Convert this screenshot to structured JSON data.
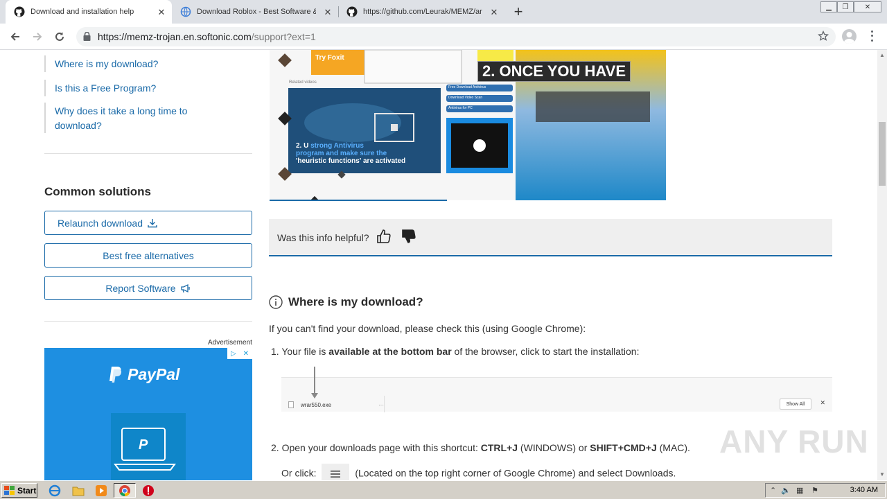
{
  "browser": {
    "tabs": [
      {
        "title": "Download and installation help",
        "active": true,
        "icon": "github-icon"
      },
      {
        "title": "Download Roblox - Best Software &",
        "active": false,
        "icon": "globe-icon"
      },
      {
        "title": "https://github.com/Leurak/MEMZ/ar",
        "active": false,
        "icon": "github-icon"
      }
    ],
    "close_glyph": "✕",
    "new_tab_glyph": "+",
    "window_controls": {
      "minimize": "▁",
      "restore": "❐",
      "close": "✕"
    },
    "url_host": "https://memz-trojan.en.softonic.com",
    "url_path": "/support?ext=1"
  },
  "sidebar": {
    "faq_links": [
      "Where is my download?",
      "Is this a Free Program?"
    ],
    "faq_link_long_1": "Why does it take a long time to",
    "faq_link_long_2": "download?",
    "common_heading": "Common solutions",
    "buttons": {
      "relaunch": "Relaunch download",
      "alternatives": "Best free alternatives",
      "report": "Report Software"
    },
    "ad_label": "Advertisement",
    "ad_brand": "PayPal"
  },
  "article": {
    "image_caption_big": "2. ONCE YOU HAVE",
    "image_caption_small_1": "2. U",
    "image_caption_small_2": "strong Antivirus",
    "image_caption_small_3": "program and make sure the",
    "image_caption_small_4": "'heuristic functions' are activated",
    "image_promo": "Try Foxit",
    "image_list_items": [
      "Free Download Antivirus",
      "Download Video Scan",
      "Antivirus for PC"
    ],
    "image_related": "Related videos",
    "helpful_question": "Was this info helpful?",
    "section_title": "Where is my download?",
    "intro": "If you can't find your download, please check this (using Google Chrome):",
    "step1_num": "1.",
    "step1_a": "Your file is ",
    "step1_b": "available at the bottom bar",
    "step1_c": " of the browser, click to start the installation:",
    "dl_filename": "wrar550.exe",
    "dl_more": "···",
    "dl_showall": "Show All",
    "dl_close": "✕",
    "step2_num": "2.",
    "step2_a": "Open your downloads page with this shortcut: ",
    "step2_b": "CTRL+J",
    "step2_c": " (WINDOWS) or ",
    "step2_d": "SHIFT+CMD+J",
    "step2_e": " (MAC).",
    "step2_or_a": "Or click: ",
    "step2_or_b": " (Located on the top right corner of Google Chrome) and select Downloads."
  },
  "watermark": "ANY RUN",
  "taskbar": {
    "start_label": "Start",
    "clock": "3:40 AM"
  },
  "colors": {
    "link": "#1a6aa8",
    "paypal_blue": "#1e8fe1",
    "tabstrip": "#dee1e6",
    "taskbar": "#d4d0c8"
  }
}
